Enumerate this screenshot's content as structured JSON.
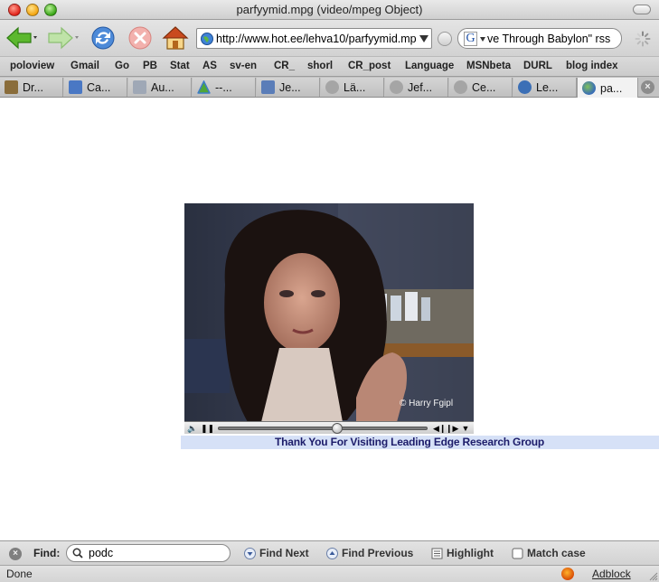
{
  "window": {
    "title": "parfyymid.mpg (video/mpeg Object)"
  },
  "navbar": {
    "url": "http://www.hot.ee/lehva10/parfyymid.mpg",
    "search_value": "ve Through Babylon\" rss"
  },
  "bookmarks": [
    "poloview",
    "Gmail",
    "Go",
    "PB",
    "Stat",
    "AS",
    "sv-en",
    "CR_",
    "shorl",
    "CR_post",
    "Language",
    "MSNbeta",
    "DURL",
    "blog index"
  ],
  "tabs": [
    {
      "label": "Dr...",
      "icon": "document-icon",
      "color": "#8a6d3b"
    },
    {
      "label": "Ca...",
      "icon": "app-icon",
      "color": "#4a78c4"
    },
    {
      "label": "Au...",
      "icon": "as-icon",
      "color": "#9fa8b6"
    },
    {
      "label": "--...",
      "icon": "triangle-icon",
      "color": "#3d7cc9"
    },
    {
      "label": "Je...",
      "icon": "chart-icon",
      "color": "#5a7db8"
    },
    {
      "label": "Lä...",
      "icon": "page-icon",
      "color": "#9a9a9a"
    },
    {
      "label": "Jef...",
      "icon": "page-icon",
      "color": "#9a9a9a"
    },
    {
      "label": "Ce...",
      "icon": "page-icon",
      "color": "#9a9a9a"
    },
    {
      "label": "Le...",
      "icon": "globe-icon",
      "color": "#3b6fb6"
    },
    {
      "label": "pa...",
      "icon": "globe-icon",
      "color": "#3b6fb6",
      "active": true
    }
  ],
  "content": {
    "video_watermark": "© Harry Fgipl",
    "banner_text": "Thank You For Visiting Leading Edge Research Group",
    "playback_progress": 0.57,
    "banner_color": "#d6e1f7"
  },
  "findbar": {
    "label": "Find:",
    "query": "podc",
    "find_next": "Find Next",
    "find_previous": "Find Previous",
    "highlight": "Highlight",
    "match_case": "Match case"
  },
  "status": {
    "text": "Done",
    "adblock": "Adblock"
  }
}
